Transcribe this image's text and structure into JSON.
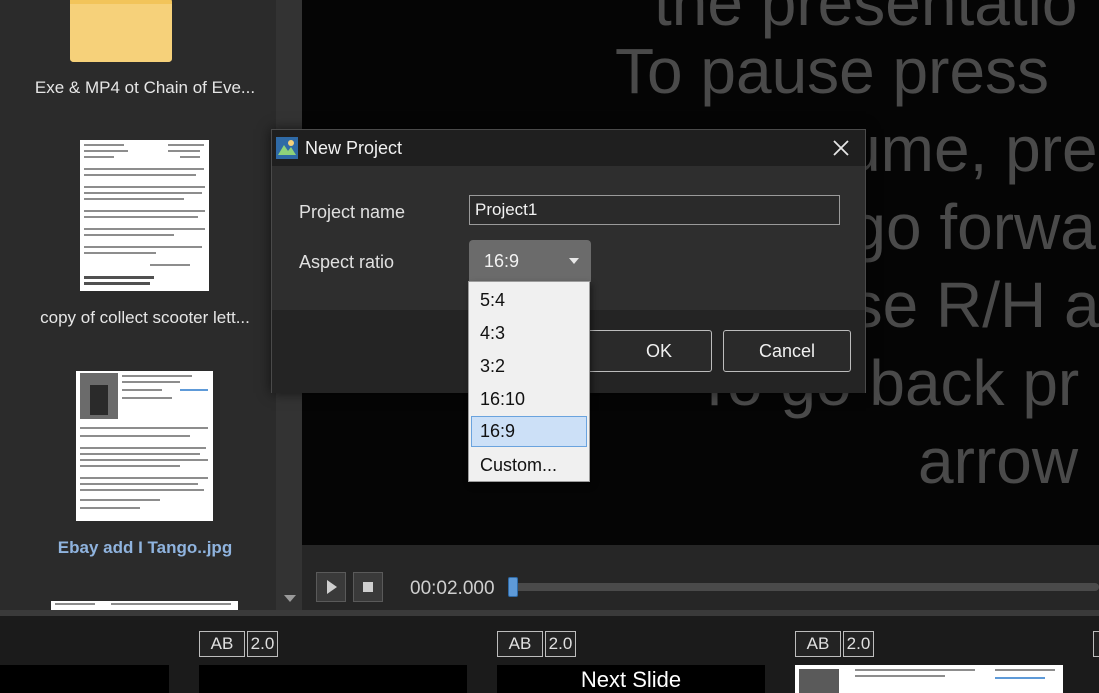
{
  "file_panel": {
    "items": [
      {
        "label": "Exe & MP4 ot Chain of Eve..."
      },
      {
        "label": "copy of collect scooter lett..."
      },
      {
        "label": "Ebay add I Tango..jpg"
      }
    ]
  },
  "preview": {
    "lines": [
      "the presentatio",
      "To pause press",
      "to resume, pre",
      "To go forward",
      "use R/H ar",
      "To go back pr",
      "arrow"
    ]
  },
  "player": {
    "time": "00:02.000",
    "progress": 0.0
  },
  "strip": {
    "slides": [
      {
        "transition": "AB",
        "duration": "2.0",
        "caption": ""
      },
      {
        "transition": "AB",
        "duration": "2.0",
        "caption": "Next Slide"
      },
      {
        "transition": "AB",
        "duration": "2.0",
        "caption": ""
      }
    ]
  },
  "dialog": {
    "title": "New Project",
    "project_name_label": "Project name",
    "project_name_value": "Project1",
    "aspect_ratio_label": "Aspect ratio",
    "aspect_ratio_value": "16:9",
    "ok_label": "OK",
    "cancel_label": "Cancel",
    "aspect_options": [
      "5:4",
      "4:3",
      "3:2",
      "16:10",
      "16:9",
      "Custom..."
    ],
    "selected_option": "16:9"
  },
  "colors": {
    "accent": "#5e9ad8",
    "selection": "#cce0f7"
  }
}
